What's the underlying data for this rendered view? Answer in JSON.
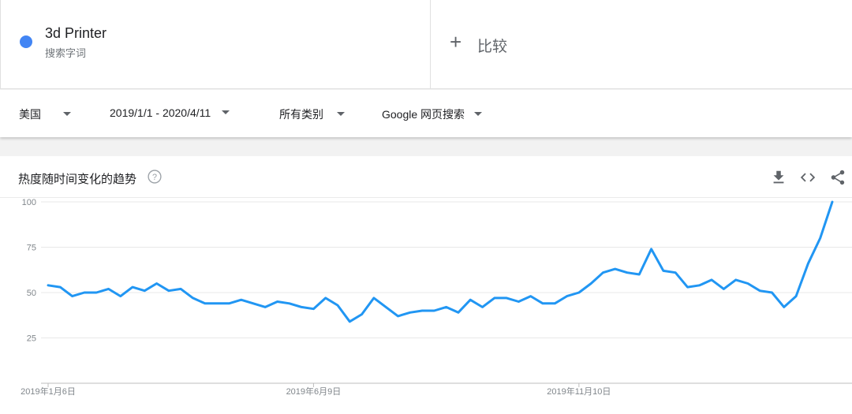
{
  "search_term": {
    "name": "3d Printer",
    "subtitle": "搜索字词",
    "color": "#4285f4"
  },
  "compare": {
    "icon": "plus-icon",
    "label": "比较"
  },
  "filters": {
    "region": "美国",
    "date_range": "2019/1/1 - 2020/4/11",
    "category": "所有类别",
    "search_type": "Google 网页搜索"
  },
  "card": {
    "title": "热度随时间变化的趋势",
    "help_icon": "help-circle-icon",
    "actions": [
      "download-icon",
      "embed-code-icon",
      "share-icon"
    ]
  },
  "chart_data": {
    "type": "line",
    "y_ticks": [
      25,
      50,
      75,
      100
    ],
    "ylim": [
      0,
      100
    ],
    "grid": true,
    "x_tick_labels": [
      {
        "index": 0,
        "label": "2019年1月6日"
      },
      {
        "index": 22,
        "label": "2019年6月9日"
      },
      {
        "index": 44,
        "label": "2019年11月10日"
      }
    ],
    "series": [
      {
        "color": "#2196f3",
        "values": [
          54,
          53,
          48,
          50,
          50,
          52,
          48,
          53,
          51,
          55,
          51,
          52,
          47,
          44,
          44,
          44,
          46,
          44,
          42,
          45,
          44,
          42,
          41,
          47,
          43,
          34,
          38,
          47,
          42,
          37,
          39,
          40,
          40,
          42,
          39,
          46,
          42,
          47,
          47,
          45,
          48,
          44,
          44,
          48,
          50,
          55,
          61,
          63,
          61,
          60,
          74,
          62,
          61,
          53,
          54,
          57,
          52,
          57,
          55,
          51,
          50,
          42,
          48,
          66,
          80,
          100
        ]
      }
    ]
  }
}
